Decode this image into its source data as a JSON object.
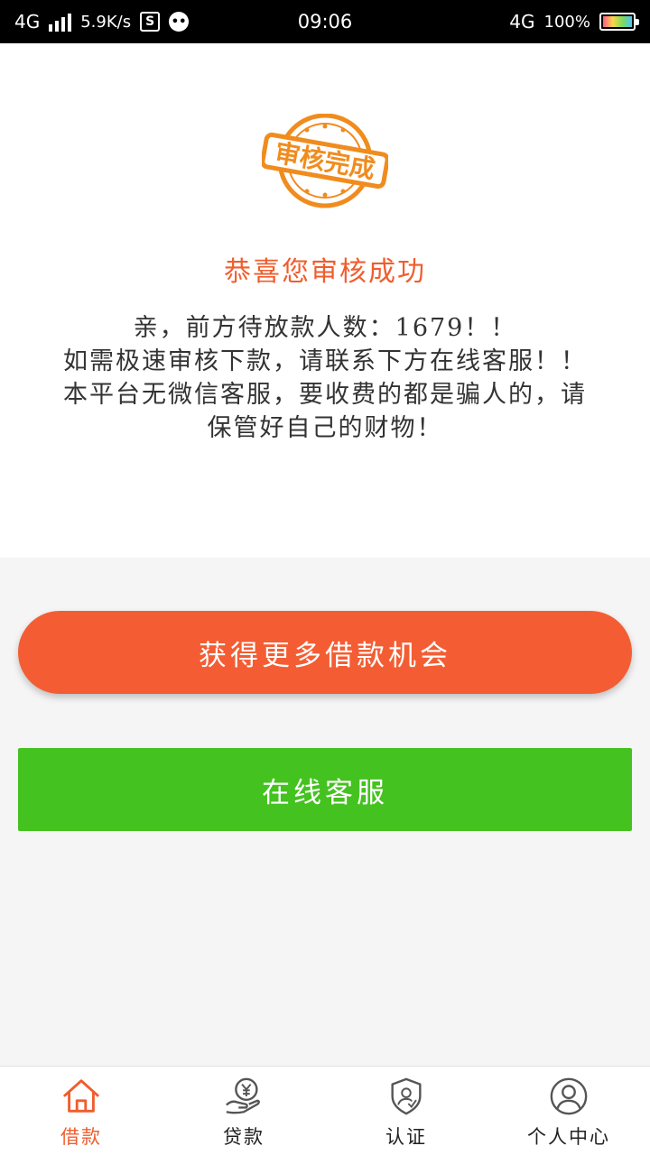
{
  "status_bar": {
    "network": "4G",
    "speed": "5.9K/s",
    "app_badge": "S",
    "time": "09:06",
    "network_right": "4G",
    "battery": "100%"
  },
  "stamp": {
    "text": "审核完成",
    "color": "#f08c1e"
  },
  "result": {
    "title": "恭喜您审核成功",
    "message_lines": [
      "亲，前方待放款人数：1679！！",
      "如需极速审核下款，请联系下方在线客服！！",
      "本平台无微信客服，要收费的都是骗人的，请",
      "保管好自己的财物！"
    ]
  },
  "buttons": {
    "more_loans": "获得更多借款机会",
    "online_service": "在线客服"
  },
  "tab_bar": {
    "items": [
      {
        "label": "借款",
        "icon": "home-icon",
        "active": true
      },
      {
        "label": "贷款",
        "icon": "yen-hand-icon",
        "active": false
      },
      {
        "label": "认证",
        "icon": "shield-check-icon",
        "active": false
      },
      {
        "label": "个人中心",
        "icon": "user-icon",
        "active": false
      }
    ]
  },
  "colors": {
    "accent": "#f05d2e",
    "orange_button": "#f45d33",
    "green_button": "#44c21f"
  }
}
